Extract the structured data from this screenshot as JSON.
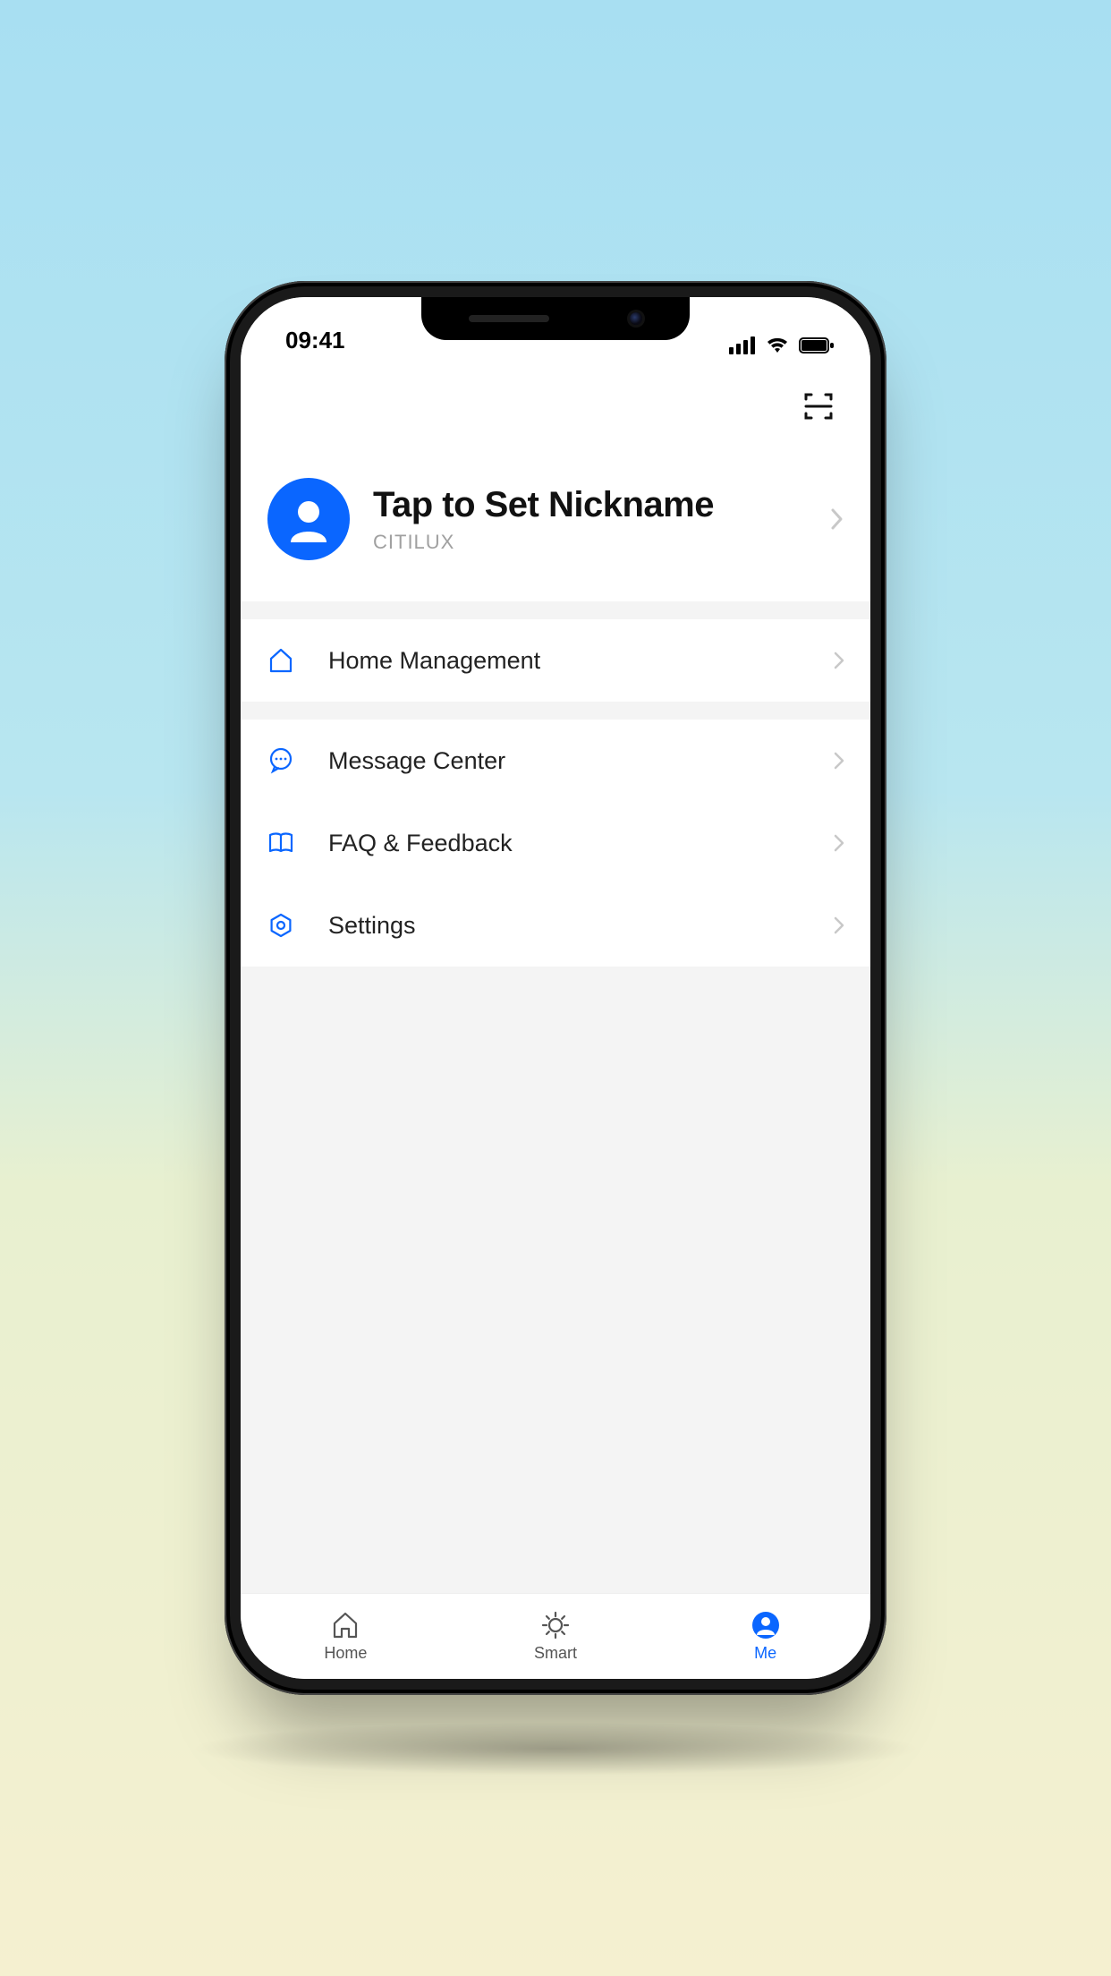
{
  "status": {
    "time": "09:41"
  },
  "profile": {
    "nickname_label": "Tap to Set Nickname",
    "account_name": "CITILUX"
  },
  "menu": {
    "home_management": "Home Management",
    "message_center": "Message Center",
    "faq_feedback": "FAQ & Feedback",
    "settings": "Settings"
  },
  "tabs": {
    "home": "Home",
    "smart": "Smart",
    "me": "Me"
  },
  "colors": {
    "accent": "#0a66ff"
  }
}
